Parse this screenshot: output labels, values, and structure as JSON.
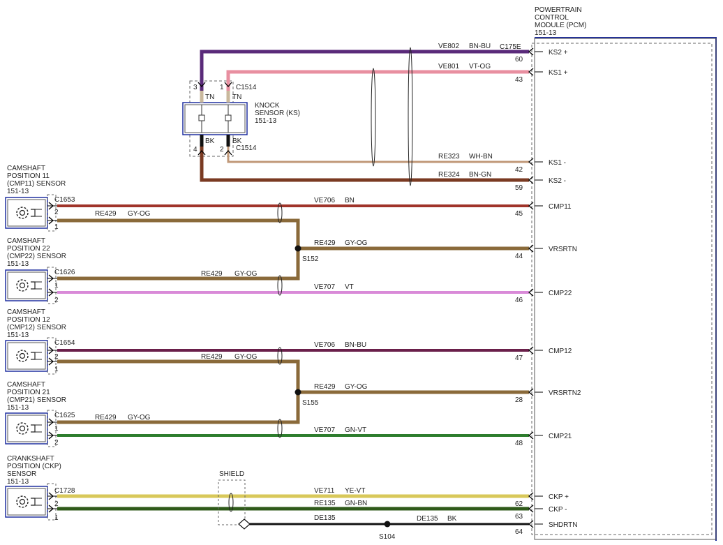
{
  "pcm": {
    "title_lines": [
      "POWERTRAIN",
      "CONTROL",
      "MODULE (PCM)",
      "151-13"
    ],
    "connector": "C175E"
  },
  "knock": {
    "title_lines": [
      "KNOCK",
      "SENSOR (KS)",
      "151-13"
    ],
    "connector_top": "C1514",
    "connector_bottom": "C1514",
    "pin_tl": "3",
    "pin_tr": "1",
    "pin_bl": "4",
    "pin_br": "2",
    "lead_top_l": "TN",
    "lead_top_r": "TN",
    "lead_bot_l": "BK",
    "lead_bot_r": "BK"
  },
  "sensors": [
    {
      "title_lines": [
        "CAMSHAFT",
        "POSITION 11",
        "(CMP11) SENSOR",
        "151-13"
      ],
      "connector": "C1653",
      "pin_a": "2",
      "pin_b": "1"
    },
    {
      "title_lines": [
        "CAMSHAFT",
        "POSITION 22",
        "(CMP22) SENSOR",
        "151-13"
      ],
      "connector": "C1626",
      "pin_a": "1",
      "pin_b": "2"
    },
    {
      "title_lines": [
        "CAMSHAFT",
        "POSITION 12",
        "(CMP12) SENSOR",
        "151-13"
      ],
      "connector": "C1654",
      "pin_a": "2",
      "pin_b": "1"
    },
    {
      "title_lines": [
        "CAMSHAFT",
        "POSITION 21",
        "(CMP21) SENSOR",
        "151-13"
      ],
      "connector": "C1625",
      "pin_a": "1",
      "pin_b": "2"
    },
    {
      "title_lines": [
        "CRANKSHAFT",
        "POSITION (CKP)",
        "SENSOR",
        "151-13"
      ],
      "connector": "C1728",
      "pin_a": "2",
      "pin_b": "1"
    }
  ],
  "circuits": [
    {
      "id": "VE802",
      "color_code": "BN-BU",
      "pin": "60",
      "signal": "KS2 +"
    },
    {
      "id": "VE801",
      "color_code": "VT-OG",
      "pin": "43",
      "signal": "KS1 +"
    },
    {
      "id": "RE323",
      "color_code": "WH-BN",
      "pin": "42",
      "signal": "KS1 -"
    },
    {
      "id": "RE324",
      "color_code": "BN-GN",
      "pin": "59",
      "signal": "KS2 -"
    },
    {
      "id": "VE706",
      "color_code": "BN",
      "pin": "45",
      "signal": "CMP11"
    },
    {
      "id": "RE429",
      "color_code": "GY-OG",
      "pin": "44",
      "signal": "VRSRTN"
    },
    {
      "id": "VE707",
      "color_code": "VT",
      "pin": "46",
      "signal": "CMP22"
    },
    {
      "id": "VE706",
      "color_code": "BN-BU",
      "pin": "47",
      "signal": "CMP12"
    },
    {
      "id": "RE429",
      "color_code": "GY-OG",
      "pin": "28",
      "signal": "VRSRTN2"
    },
    {
      "id": "VE707",
      "color_code": "GN-VT",
      "pin": "48",
      "signal": "CMP21"
    },
    {
      "id": "VE711",
      "color_code": "YE-VT",
      "pin": "62",
      "signal": "CKP +"
    },
    {
      "id": "RE135",
      "color_code": "GN-BN",
      "pin": "63",
      "signal": "CKP -"
    },
    {
      "id": "DE135",
      "color_code": "BK",
      "pin": "64",
      "signal": "SHDRTN"
    }
  ],
  "branch_labels": [
    {
      "id": "RE429",
      "color_code": "GY-OG"
    },
    {
      "id": "RE429",
      "color_code": "GY-OG"
    },
    {
      "id": "RE429",
      "color_code": "GY-OG"
    },
    {
      "id": "RE429",
      "color_code": "GY-OG"
    },
    {
      "id": "DE135",
      "color_code": ""
    }
  ],
  "splices": [
    "S152",
    "S155",
    "S104"
  ],
  "shield_label": "SHIELD",
  "wire_colors": {
    "BN-BU": "#5a2a7a",
    "VT-OG": "#e88fa0",
    "WH-BN": "#b08060",
    "BN-GN": "#7a3a22",
    "BN": "#a0342a",
    "GY-OG": "#8a6a3a",
    "VT": "#d98ad8",
    "BN-BU-CMP12": "#6a1f4a",
    "GN-VT": "#2e7d2e",
    "YE-VT": "#d8c85a",
    "GN-BN": "#2f5a1a",
    "BK": "#111111",
    "module_border": "#2030a0"
  }
}
